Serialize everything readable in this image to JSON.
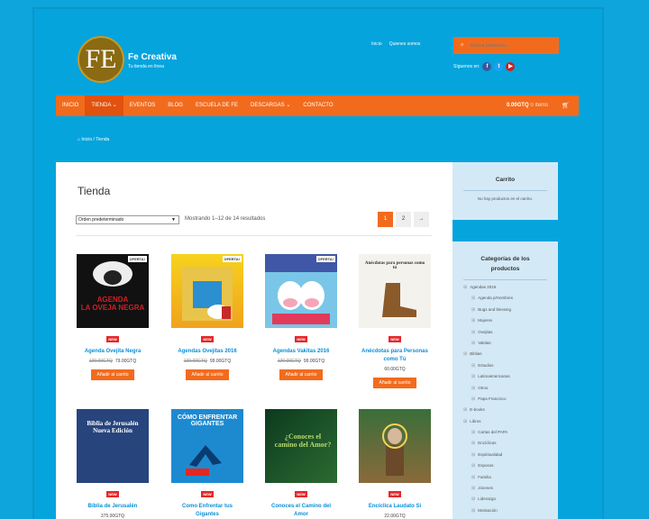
{
  "site": {
    "logo_text": "FE",
    "title": "Fe Creativa",
    "tagline": "Tu tienda en línea"
  },
  "top_links": [
    "Inicio",
    "Quienes somos"
  ],
  "search": {
    "placeholder": "Buscar productos..."
  },
  "social": {
    "label": "Síguenos en:",
    "icons": [
      "facebook-icon",
      "twitter-icon",
      "youtube-icon"
    ]
  },
  "nav": {
    "items": [
      "INICIO",
      "TIENDA ⌄",
      "EVENTOS",
      "BLOG",
      "ESCUELA DE FE",
      "DESCARGAS ⌄",
      "CONTACTO"
    ],
    "cart_total": "0.00GTQ",
    "cart_items": "0 ítems"
  },
  "breadcrumb": {
    "home": "Inicio",
    "current": "/ Tienda"
  },
  "shop": {
    "title": "Tienda",
    "order_select": "Orden predeterminado",
    "result_count": "Mostrando 1–12 de 14 resultados",
    "pages": [
      "1",
      "2",
      "→"
    ]
  },
  "products": [
    {
      "name": "Agenda Ovejita Negra",
      "old_price": "120.00GTQ",
      "price": "79.00GTQ",
      "badge": "NEW",
      "sale": "OFERTA!",
      "cover": "AGENDA\nLA OVEJA NEGRA",
      "button": "Añadir al carrito"
    },
    {
      "name": "Agendas Ovejitas 2016",
      "old_price": "120.00GTQ",
      "price": "99.00GTQ",
      "badge": "NEW",
      "sale": "OFERTA!",
      "cover": "",
      "button": "Añadir al carrito"
    },
    {
      "name": "Agendas Vakitas 2016",
      "old_price": "120.00GTQ",
      "price": "99.00GTQ",
      "badge": "NEW",
      "sale": "OFERTA!",
      "cover": "",
      "button": "Añadir al carrito"
    },
    {
      "name": "Anécdotas para Personas como Tú",
      "old_price": "",
      "price": "60.00GTQ",
      "badge": "NEW",
      "sale": "",
      "cover": "Anécdotas para personas como tú",
      "button": "Añadir al carrito"
    },
    {
      "name": "Biblia de Jerusalén",
      "old_price": "",
      "price": "375.00GTQ",
      "badge": "NEW",
      "sale": "",
      "cover": "Biblia de Jerusalén Nueva Edición",
      "button": ""
    },
    {
      "name": "Como Enfrentar tus Gigantes",
      "old_price": "",
      "price": "",
      "badge": "NEW",
      "sale": "",
      "cover": "CÓMO ENFRENTAR GIGANTES",
      "button": ""
    },
    {
      "name": "Conoces el Camino del Amor",
      "old_price": "",
      "price": "",
      "badge": "NEW",
      "sale": "",
      "cover": "¿Conoces el camino del Amor?",
      "button": ""
    },
    {
      "name": "Encíclica Laudato Si",
      "old_price": "",
      "price": "22.00GTQ",
      "badge": "NEW",
      "sale": "",
      "cover": "",
      "button": ""
    }
  ],
  "sidebar": {
    "cart_title": "Carrito",
    "cart_empty": "No hay productos en el carrito.",
    "categories_title": "Categorías de los productos",
    "categories": [
      {
        "label": "Agendas 2016",
        "level": 0
      },
      {
        "label": "Agenda p/Hombres",
        "level": 1
      },
      {
        "label": "Bugs and blessing",
        "level": 1
      },
      {
        "label": "Mujeres",
        "level": 1
      },
      {
        "label": "Ovejitas",
        "level": 1
      },
      {
        "label": "Vakitas",
        "level": 1
      },
      {
        "label": "Biblias",
        "level": 0
      },
      {
        "label": "Estudios",
        "level": 1
      },
      {
        "label": "Latinoamericanas",
        "level": 1
      },
      {
        "label": "Otros",
        "level": 1
      },
      {
        "label": "Papa Francisco",
        "level": 1
      },
      {
        "label": "E-books",
        "level": 0
      },
      {
        "label": "Libros",
        "level": 0
      },
      {
        "label": "Cartas del PAPA",
        "level": 1
      },
      {
        "label": "Encíclicas",
        "level": 1
      },
      {
        "label": "Espiritualidad",
        "level": 1
      },
      {
        "label": "Esposos",
        "level": 1
      },
      {
        "label": "Familia",
        "level": 1
      },
      {
        "label": "Jóvenes",
        "level": 1
      },
      {
        "label": "Liderazgo",
        "level": 1
      },
      {
        "label": "Motivación",
        "level": 1
      }
    ]
  },
  "colors": {
    "background": "#0ea4dc",
    "accent": "#f26b1d",
    "link": "#0a8fd4",
    "badge": "#e5282a",
    "widget": "#d3e9f6"
  }
}
